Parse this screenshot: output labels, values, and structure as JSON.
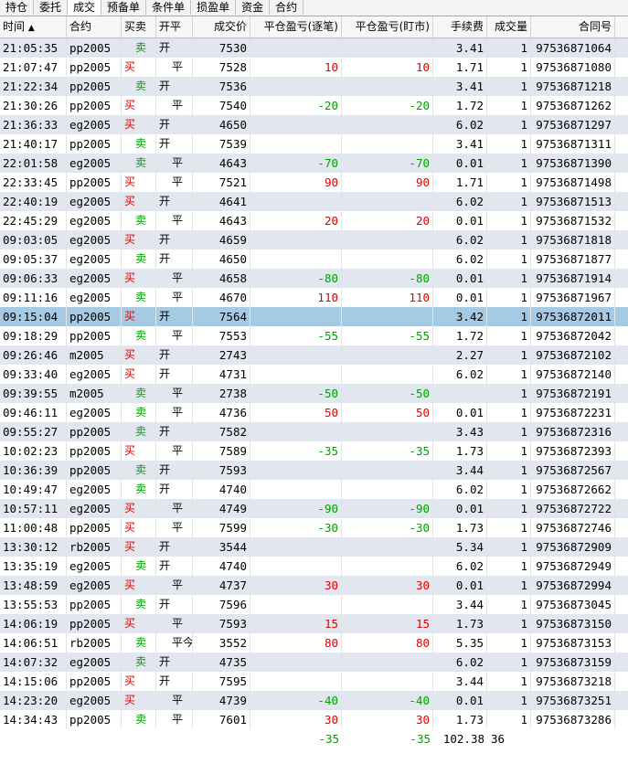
{
  "tabs": [
    "持仓",
    "委托",
    "成交",
    "预备单",
    "条件单",
    "损盈单",
    "资金",
    "合约"
  ],
  "active_tab": "成交",
  "columns": {
    "time": "时间",
    "sort_icon": "▲",
    "contract": "合约",
    "side": "买卖",
    "open_close": "开平",
    "price": "成交价",
    "pnl_trade": "平仓盈亏(逐笔)",
    "pnl_mark": "平仓盈亏(盯市)",
    "fee": "手续费",
    "volume": "成交量",
    "contract_no": "合同号"
  },
  "rows": [
    {
      "time": "21:05:35",
      "contract": "pp2005",
      "side": "卖",
      "oc": "开",
      "price": "7530",
      "pnl1": "",
      "pnl2": "",
      "fee": "3.41",
      "vol": "1",
      "id": "97536871064"
    },
    {
      "time": "21:07:47",
      "contract": "pp2005",
      "side": "买",
      "oc": "平",
      "price": "7528",
      "pnl1": "10",
      "pnl2": "10",
      "fee": "1.71",
      "vol": "1",
      "id": "97536871080"
    },
    {
      "time": "21:22:34",
      "contract": "pp2005",
      "side": "卖",
      "oc": "开",
      "price": "7536",
      "pnl1": "",
      "pnl2": "",
      "fee": "3.41",
      "vol": "1",
      "id": "97536871218"
    },
    {
      "time": "21:30:26",
      "contract": "pp2005",
      "side": "买",
      "oc": "平",
      "price": "7540",
      "pnl1": "-20",
      "pnl2": "-20",
      "fee": "1.72",
      "vol": "1",
      "id": "97536871262"
    },
    {
      "time": "21:36:33",
      "contract": "eg2005",
      "side": "买",
      "oc": "开",
      "price": "4650",
      "pnl1": "",
      "pnl2": "",
      "fee": "6.02",
      "vol": "1",
      "id": "97536871297"
    },
    {
      "time": "21:40:17",
      "contract": "pp2005",
      "side": "卖",
      "oc": "开",
      "price": "7539",
      "pnl1": "",
      "pnl2": "",
      "fee": "3.41",
      "vol": "1",
      "id": "97536871311"
    },
    {
      "time": "22:01:58",
      "contract": "eg2005",
      "side": "卖",
      "oc": "平",
      "price": "4643",
      "pnl1": "-70",
      "pnl2": "-70",
      "fee": "0.01",
      "vol": "1",
      "id": "97536871390"
    },
    {
      "time": "22:33:45",
      "contract": "pp2005",
      "side": "买",
      "oc": "平",
      "price": "7521",
      "pnl1": "90",
      "pnl2": "90",
      "fee": "1.71",
      "vol": "1",
      "id": "97536871498"
    },
    {
      "time": "22:40:19",
      "contract": "eg2005",
      "side": "买",
      "oc": "开",
      "price": "4641",
      "pnl1": "",
      "pnl2": "",
      "fee": "6.02",
      "vol": "1",
      "id": "97536871513"
    },
    {
      "time": "22:45:29",
      "contract": "eg2005",
      "side": "卖",
      "oc": "平",
      "price": "4643",
      "pnl1": "20",
      "pnl2": "20",
      "fee": "0.01",
      "vol": "1",
      "id": "97536871532"
    },
    {
      "time": "09:03:05",
      "contract": "eg2005",
      "side": "买",
      "oc": "开",
      "price": "4659",
      "pnl1": "",
      "pnl2": "",
      "fee": "6.02",
      "vol": "1",
      "id": "97536871818"
    },
    {
      "time": "09:05:37",
      "contract": "eg2005",
      "side": "卖",
      "oc": "开",
      "price": "4650",
      "pnl1": "",
      "pnl2": "",
      "fee": "6.02",
      "vol": "1",
      "id": "97536871877"
    },
    {
      "time": "09:06:33",
      "contract": "eg2005",
      "side": "买",
      "oc": "平",
      "price": "4658",
      "pnl1": "-80",
      "pnl2": "-80",
      "fee": "0.01",
      "vol": "1",
      "id": "97536871914"
    },
    {
      "time": "09:11:16",
      "contract": "eg2005",
      "side": "卖",
      "oc": "平",
      "price": "4670",
      "pnl1": "110",
      "pnl2": "110",
      "fee": "0.01",
      "vol": "1",
      "id": "97536871967"
    },
    {
      "time": "09:15:04",
      "contract": "pp2005",
      "side": "买",
      "oc": "开",
      "price": "7564",
      "pnl1": "",
      "pnl2": "",
      "fee": "3.42",
      "vol": "1",
      "id": "97536872011",
      "selected": true
    },
    {
      "time": "09:18:29",
      "contract": "pp2005",
      "side": "卖",
      "oc": "平",
      "price": "7553",
      "pnl1": "-55",
      "pnl2": "-55",
      "fee": "1.72",
      "vol": "1",
      "id": "97536872042"
    },
    {
      "time": "09:26:46",
      "contract": "m2005",
      "side": "买",
      "oc": "开",
      "price": "2743",
      "pnl1": "",
      "pnl2": "",
      "fee": "2.27",
      "vol": "1",
      "id": "97536872102"
    },
    {
      "time": "09:33:40",
      "contract": "eg2005",
      "side": "买",
      "oc": "开",
      "price": "4731",
      "pnl1": "",
      "pnl2": "",
      "fee": "6.02",
      "vol": "1",
      "id": "97536872140"
    },
    {
      "time": "09:39:55",
      "contract": "m2005",
      "side": "卖",
      "oc": "平",
      "price": "2738",
      "pnl1": "-50",
      "pnl2": "-50",
      "fee": "",
      "vol": "1",
      "id": "97536872191"
    },
    {
      "time": "09:46:11",
      "contract": "eg2005",
      "side": "卖",
      "oc": "平",
      "price": "4736",
      "pnl1": "50",
      "pnl2": "50",
      "fee": "0.01",
      "vol": "1",
      "id": "97536872231"
    },
    {
      "time": "09:55:27",
      "contract": "pp2005",
      "side": "卖",
      "oc": "开",
      "price": "7582",
      "pnl1": "",
      "pnl2": "",
      "fee": "3.43",
      "vol": "1",
      "id": "97536872316"
    },
    {
      "time": "10:02:23",
      "contract": "pp2005",
      "side": "买",
      "oc": "平",
      "price": "7589",
      "pnl1": "-35",
      "pnl2": "-35",
      "fee": "1.73",
      "vol": "1",
      "id": "97536872393"
    },
    {
      "time": "10:36:39",
      "contract": "pp2005",
      "side": "卖",
      "oc": "开",
      "price": "7593",
      "pnl1": "",
      "pnl2": "",
      "fee": "3.44",
      "vol": "1",
      "id": "97536872567"
    },
    {
      "time": "10:49:47",
      "contract": "eg2005",
      "side": "卖",
      "oc": "开",
      "price": "4740",
      "pnl1": "",
      "pnl2": "",
      "fee": "6.02",
      "vol": "1",
      "id": "97536872662"
    },
    {
      "time": "10:57:11",
      "contract": "eg2005",
      "side": "买",
      "oc": "平",
      "price": "4749",
      "pnl1": "-90",
      "pnl2": "-90",
      "fee": "0.01",
      "vol": "1",
      "id": "97536872722"
    },
    {
      "time": "11:00:48",
      "contract": "pp2005",
      "side": "买",
      "oc": "平",
      "price": "7599",
      "pnl1": "-30",
      "pnl2": "-30",
      "fee": "1.73",
      "vol": "1",
      "id": "97536872746"
    },
    {
      "time": "13:30:12",
      "contract": "rb2005",
      "side": "买",
      "oc": "开",
      "price": "3544",
      "pnl1": "",
      "pnl2": "",
      "fee": "5.34",
      "vol": "1",
      "id": "97536872909"
    },
    {
      "time": "13:35:19",
      "contract": "eg2005",
      "side": "卖",
      "oc": "开",
      "price": "4740",
      "pnl1": "",
      "pnl2": "",
      "fee": "6.02",
      "vol": "1",
      "id": "97536872949"
    },
    {
      "time": "13:48:59",
      "contract": "eg2005",
      "side": "买",
      "oc": "平",
      "price": "4737",
      "pnl1": "30",
      "pnl2": "30",
      "fee": "0.01",
      "vol": "1",
      "id": "97536872994"
    },
    {
      "time": "13:55:53",
      "contract": "pp2005",
      "side": "卖",
      "oc": "开",
      "price": "7596",
      "pnl1": "",
      "pnl2": "",
      "fee": "3.44",
      "vol": "1",
      "id": "97536873045"
    },
    {
      "time": "14:06:19",
      "contract": "pp2005",
      "side": "买",
      "oc": "平",
      "price": "7593",
      "pnl1": "15",
      "pnl2": "15",
      "fee": "1.73",
      "vol": "1",
      "id": "97536873150"
    },
    {
      "time": "14:06:51",
      "contract": "rb2005",
      "side": "卖",
      "oc": "平今",
      "price": "3552",
      "pnl1": "80",
      "pnl2": "80",
      "fee": "5.35",
      "vol": "1",
      "id": "97536873153"
    },
    {
      "time": "14:07:32",
      "contract": "eg2005",
      "side": "卖",
      "oc": "开",
      "price": "4735",
      "pnl1": "",
      "pnl2": "",
      "fee": "6.02",
      "vol": "1",
      "id": "97536873159"
    },
    {
      "time": "14:15:06",
      "contract": "pp2005",
      "side": "买",
      "oc": "开",
      "price": "7595",
      "pnl1": "",
      "pnl2": "",
      "fee": "3.44",
      "vol": "1",
      "id": "97536873218"
    },
    {
      "time": "14:23:20",
      "contract": "eg2005",
      "side": "买",
      "oc": "平",
      "price": "4739",
      "pnl1": "-40",
      "pnl2": "-40",
      "fee": "0.01",
      "vol": "1",
      "id": "97536873251"
    },
    {
      "time": "14:34:43",
      "contract": "pp2005",
      "side": "卖",
      "oc": "平",
      "price": "7601",
      "pnl1": "30",
      "pnl2": "30",
      "fee": "1.73",
      "vol": "1",
      "id": "97536873286"
    }
  ],
  "totals": {
    "pnl1": "-35",
    "pnl2": "-35",
    "fee": "102.38",
    "vol": "36"
  },
  "colors": {
    "buy": "#e00000",
    "sell": "#00a000",
    "selected_row": "#a6cae3",
    "stripe": "#e2e7ef"
  }
}
